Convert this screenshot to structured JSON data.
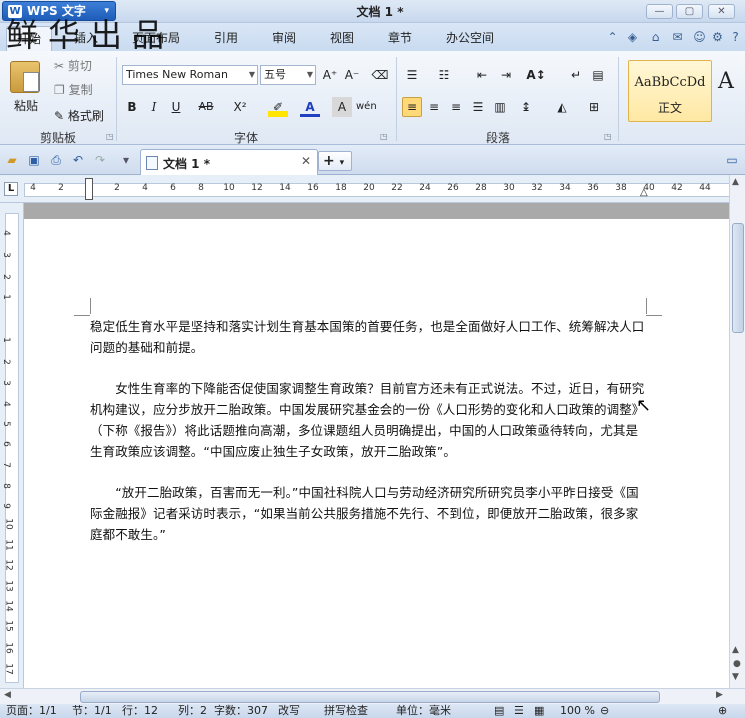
{
  "app": {
    "name": "WPS 文字",
    "document_title": "文档 1 *"
  },
  "watermark": "鲜华出品",
  "menu_tabs": [
    "开始",
    "插入",
    "页面布局",
    "引用",
    "审阅",
    "视图",
    "章节",
    "办公空间"
  ],
  "active_tab": "开始",
  "ribbon": {
    "clipboard": {
      "label": "剪贴板",
      "paste": "粘贴",
      "cut": "剪切",
      "copy": "复制",
      "format_painter": "格式刷"
    },
    "font": {
      "label": "字体",
      "font_name": "Times New Roman",
      "font_size": "五号"
    },
    "paragraph": {
      "label": "段落"
    },
    "styles": {
      "sample": "AaBbCcDd",
      "name": "正文"
    }
  },
  "quickbar": {
    "doc_tab": "文档 1 *"
  },
  "ruler_numbers": [
    "4",
    "2",
    "2",
    "4",
    "6",
    "8",
    "10",
    "12",
    "14",
    "16",
    "18",
    "20",
    "22",
    "24",
    "26",
    "28",
    "30",
    "32",
    "34",
    "36",
    "38",
    "40",
    "42",
    "44"
  ],
  "vruler_numbers": [
    "4",
    "3",
    "2",
    "1",
    "1",
    "2",
    "3",
    "4",
    "5",
    "6",
    "7",
    "8",
    "9",
    "10",
    "11",
    "12",
    "13",
    "14",
    "15",
    "16",
    "17"
  ],
  "document": {
    "paragraphs": [
      "稳定低生育水平是坚持和落实计划生育基本国策的首要任务，也是全面做好人口工作、统筹解决人口问题的基础和前提。",
      "　　女性生育率的下降能否促使国家调整生育政策？目前官方还未有正式说法。不过，近日，有研究机构建议，应分步放开二胎政策。中国发展研究基金会的一份《人口形势的变化和人口政策的调整》（下称《报告》）将此话题推向高潮，多位课题组人员明确提出，中国的人口政策亟待转向，尤其是生育政策应该调整。“中国应废止独生子女政策，放开二胎政策”。",
      "　　“放开二胎政策，百害而无一利。”中国社科院人口与劳动经济研究所研究员李小平昨日接受《国际金融报》记者采访时表示，“如果当前公共服务措施不先行、不到位，即便放开二胎政策，很多家庭都不敢生。”"
    ]
  },
  "statusbar": {
    "page": "页面：1/1",
    "section": "节：1/1",
    "row": "行：12",
    "col": "列：2",
    "word_count": "字数：307",
    "revise": "改写",
    "spell": "拼写检查",
    "unit": "单位：毫米",
    "zoom": "100 %"
  }
}
